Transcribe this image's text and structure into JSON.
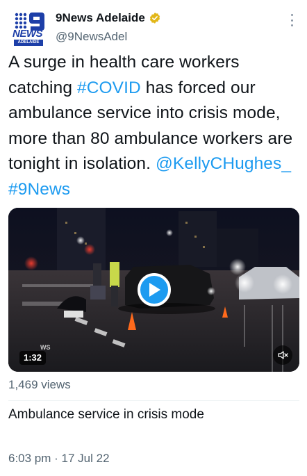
{
  "account": {
    "display_name": "9News Adelaide",
    "handle": "@9NewsAdel",
    "verified": true,
    "avatar_logo_text": "NEWS",
    "avatar_logo_subtext": "ADELAIDE",
    "avatar_color": "#1d3fa8"
  },
  "tweet": {
    "text_part1": "A surge in health care workers catching ",
    "hashtag_covid": "#COVID",
    "text_part2": " has forced our ambulance service into crisis mode, more than 80 ambulance workers are tonight in isolation. ",
    "mention": "@KellyCHughes_",
    "hashtag_news": "#9News",
    "link_color": "#1d9bf0"
  },
  "video": {
    "duration": "1:32",
    "watermark": "WS",
    "views": "1,469 views",
    "caption": "Ambulance service in crisis mode"
  },
  "meta": {
    "timestamp": "6:03 pm · 17 Jul 22"
  },
  "icons": [
    "verified-badge-icon",
    "more-options-icon",
    "play-icon",
    "mute-icon"
  ]
}
